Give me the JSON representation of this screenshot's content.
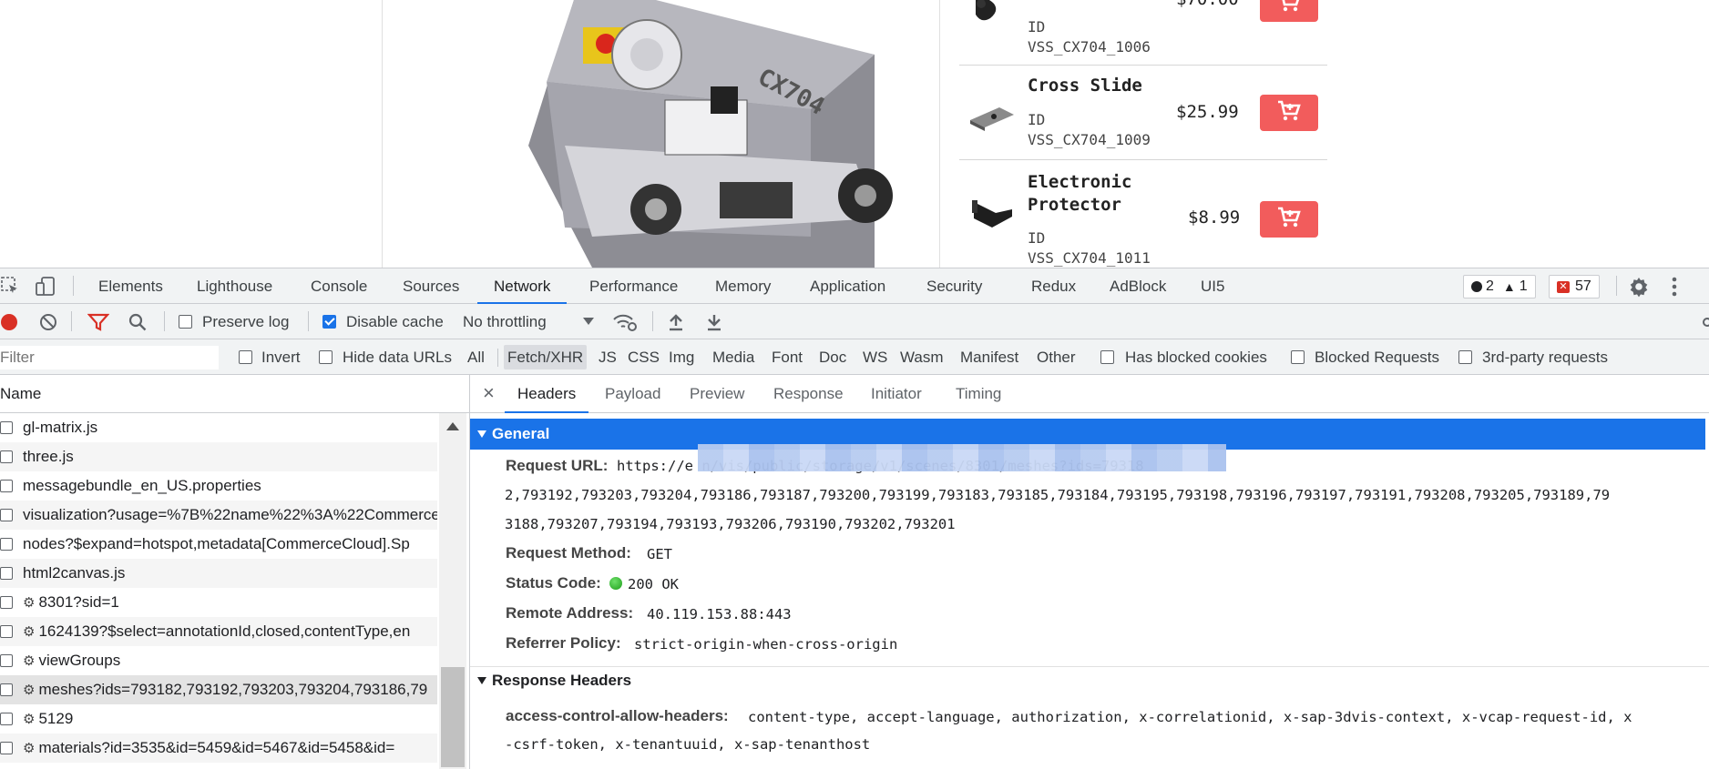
{
  "page": {
    "products": [
      {
        "name": "",
        "id_label": "ID",
        "id": "VSS_CX704_1006",
        "price": "$70.00"
      },
      {
        "name": "Cross Slide",
        "id_label": "ID",
        "id": "VSS_CX704_1009",
        "price": "$25.99"
      },
      {
        "name": "Electronic Protector",
        "id_label": "ID",
        "id": "VSS_CX704_1011",
        "price": "$8.99"
      }
    ],
    "machine_label": "CX704"
  },
  "devtools": {
    "tabs": [
      "Elements",
      "Lighthouse",
      "Console",
      "Sources",
      "Network",
      "Performance",
      "Memory",
      "Application",
      "Security",
      "Redux",
      "AdBlock",
      "UI5"
    ],
    "active_tab": "Network",
    "badges": {
      "errors": "2",
      "warnings": "1",
      "issues": "57"
    },
    "toolbar": {
      "preserve_log": "Preserve log",
      "disable_cache": "Disable cache",
      "throttling": "No throttling"
    },
    "filterbar": {
      "filter_placeholder": "Filter",
      "invert": "Invert",
      "hide_data_urls": "Hide data URLs",
      "types": [
        "All",
        "Fetch/XHR",
        "JS",
        "CSS",
        "Img",
        "Media",
        "Font",
        "Doc",
        "WS",
        "Wasm",
        "Manifest",
        "Other"
      ],
      "selected_type": "Fetch/XHR",
      "has_blocked_cookies": "Has blocked cookies",
      "blocked_requests": "Blocked Requests",
      "third_party": "3rd-party requests"
    },
    "requests": {
      "column_name": "Name",
      "rows": [
        {
          "name": "gl-matrix.js",
          "xhr": false
        },
        {
          "name": "three.js",
          "xhr": false
        },
        {
          "name": "messagebundle_en_US.properties",
          "xhr": false
        },
        {
          "name": "visualization?usage=%7B%22name%22%3A%22Commerce",
          "xhr": false
        },
        {
          "name": "nodes?$expand=hotspot,metadata[CommerceCloud].Sp",
          "xhr": false
        },
        {
          "name": "html2canvas.js",
          "xhr": false
        },
        {
          "name": "8301?sid=1",
          "xhr": true
        },
        {
          "name": "1624139?$select=annotationId,closed,contentType,en",
          "xhr": true
        },
        {
          "name": "viewGroups",
          "xhr": true
        },
        {
          "name": "meshes?ids=793182,793192,793203,793204,793186,79",
          "xhr": true
        },
        {
          "name": "5129",
          "xhr": true
        },
        {
          "name": "materials?id=3535&id=5459&id=5467&id=5458&id=",
          "xhr": true
        }
      ]
    },
    "detail": {
      "close": "×",
      "tabs": [
        "Headers",
        "Payload",
        "Preview",
        "Response",
        "Initiator",
        "Timing"
      ],
      "active_tab": "Headers",
      "general_title": "General",
      "request_url_key": "Request URL:",
      "request_url_lines": [
        "https://e                                                     n/vis/public/storage/v1/scenes/8301/meshes?ids=79318",
        "2,793192,793203,793204,793186,793187,793200,793199,793183,793185,793184,793195,793198,793196,793197,793191,793208,793205,793189,79",
        "3188,793207,793194,793193,793206,793190,793202,793201"
      ],
      "request_method_key": "Request Method:",
      "request_method": "GET",
      "status_code_key": "Status Code:",
      "status_code": "200 OK",
      "remote_address_key": "Remote Address:",
      "remote_address": "40.119.153.88:443",
      "referrer_policy_key": "Referrer Policy:",
      "referrer_policy": "strict-origin-when-cross-origin",
      "response_headers_title": "Response Headers",
      "acah_key": "access-control-allow-headers:",
      "acah_line1": "content-type, accept-language, authorization, x-correlationid, x-sap-3dvis-context, x-vcap-request-id, x",
      "acah_line2": "-csrf-token, x-tenantuuid, x-sap-tenanthost"
    }
  },
  "colors": {
    "accent": "#1a73e8",
    "record": "#d93025",
    "cart": "#f25c5c"
  }
}
